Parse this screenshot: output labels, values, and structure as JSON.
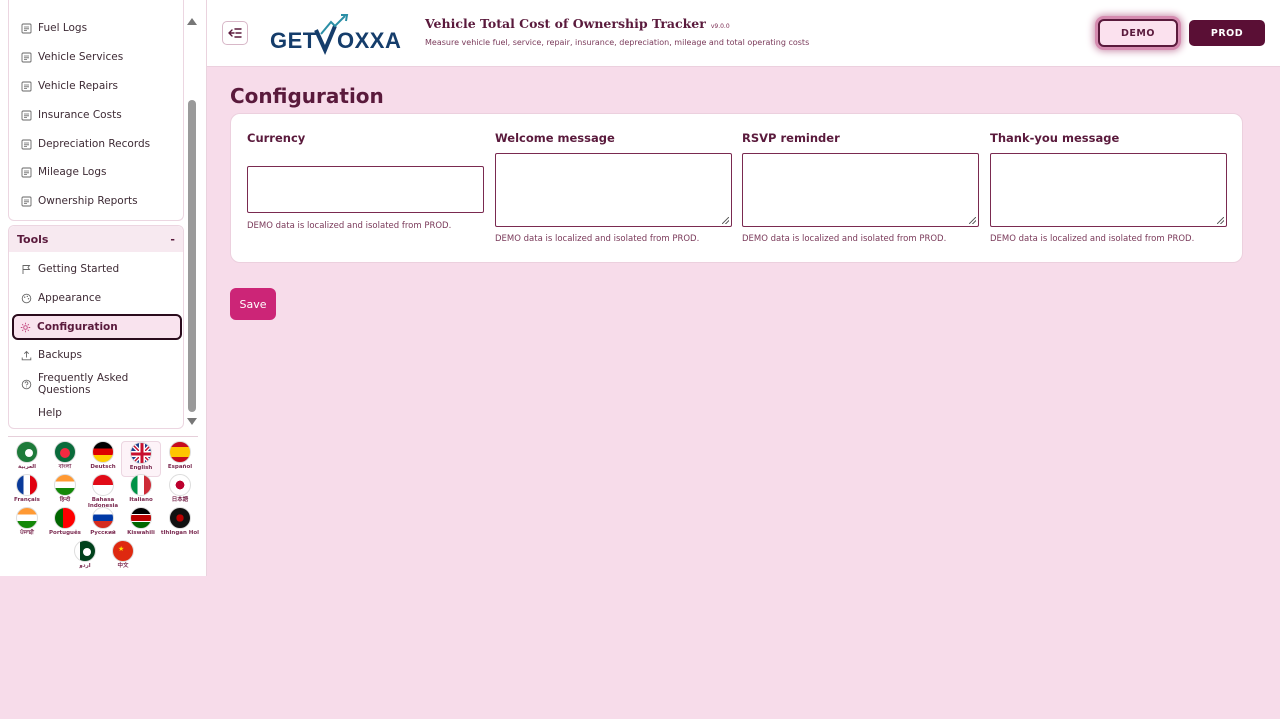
{
  "sidebar": {
    "top_items": [
      {
        "label": "Fuel Logs",
        "icon": "list-icon"
      },
      {
        "label": "Vehicle Services",
        "icon": "list-icon"
      },
      {
        "label": "Vehicle Repairs",
        "icon": "list-icon"
      },
      {
        "label": "Insurance Costs",
        "icon": "list-icon"
      },
      {
        "label": "Depreciation Records",
        "icon": "list-icon"
      },
      {
        "label": "Mileage Logs",
        "icon": "list-icon"
      },
      {
        "label": "Ownership Reports",
        "icon": "list-icon"
      }
    ],
    "tools": {
      "title": "Tools",
      "toggle": "-",
      "items": [
        {
          "label": "Getting Started",
          "icon": "flag-icon"
        },
        {
          "label": "Appearance",
          "icon": "palette-icon"
        },
        {
          "label": "Configuration",
          "icon": "gear-icon",
          "active": true
        },
        {
          "label": "Backups",
          "icon": "upload-icon"
        },
        {
          "label": "Frequently Asked Questions",
          "icon": "question-icon"
        },
        {
          "label": "Help",
          "icon": ""
        }
      ]
    }
  },
  "languages": [
    {
      "label": "العربية"
    },
    {
      "label": "বাংলা"
    },
    {
      "label": "Deutsch"
    },
    {
      "label": "English",
      "selected": true
    },
    {
      "label": "Español"
    },
    {
      "label": "Français"
    },
    {
      "label": "हिन्दी"
    },
    {
      "label": "Bahasa Indonesia"
    },
    {
      "label": "Italiano"
    },
    {
      "label": "日本語"
    },
    {
      "label": "ਪੰਜਾਬੀ"
    },
    {
      "label": "Português"
    },
    {
      "label": "Русский"
    },
    {
      "label": "Kiswahili"
    },
    {
      "label": "tlhIngan Hol"
    },
    {
      "label": "اردو"
    },
    {
      "label": "中文"
    }
  ],
  "header": {
    "logo_text": "GETVOXXA",
    "title": "Vehicle Total Cost of Ownership Tracker",
    "version": "v9.0.0",
    "subtitle": "Measure vehicle fuel, service, repair, insurance, depreciation, mileage and total operating costs",
    "demo_label": "DEMO",
    "prod_label": "PROD",
    "collapse_icon": "collapse-sidebar-icon"
  },
  "main": {
    "page_title": "Configuration",
    "fields": [
      {
        "label": "Currency",
        "value": "",
        "type": "input",
        "help": "DEMO data is localized and isolated from PROD."
      },
      {
        "label": "Welcome message",
        "value": "",
        "type": "textarea",
        "help": "DEMO data is localized and isolated from PROD."
      },
      {
        "label": "RSVP reminder",
        "value": "",
        "type": "textarea",
        "help": "DEMO data is localized and isolated from PROD."
      },
      {
        "label": "Thank-you message",
        "value": "",
        "type": "textarea",
        "help": "DEMO data is localized and isolated from PROD."
      }
    ],
    "save_label": "Save"
  },
  "colors": {
    "accent": "#5a1a3c",
    "save": "#cc2577",
    "background": "#f7dcea"
  }
}
